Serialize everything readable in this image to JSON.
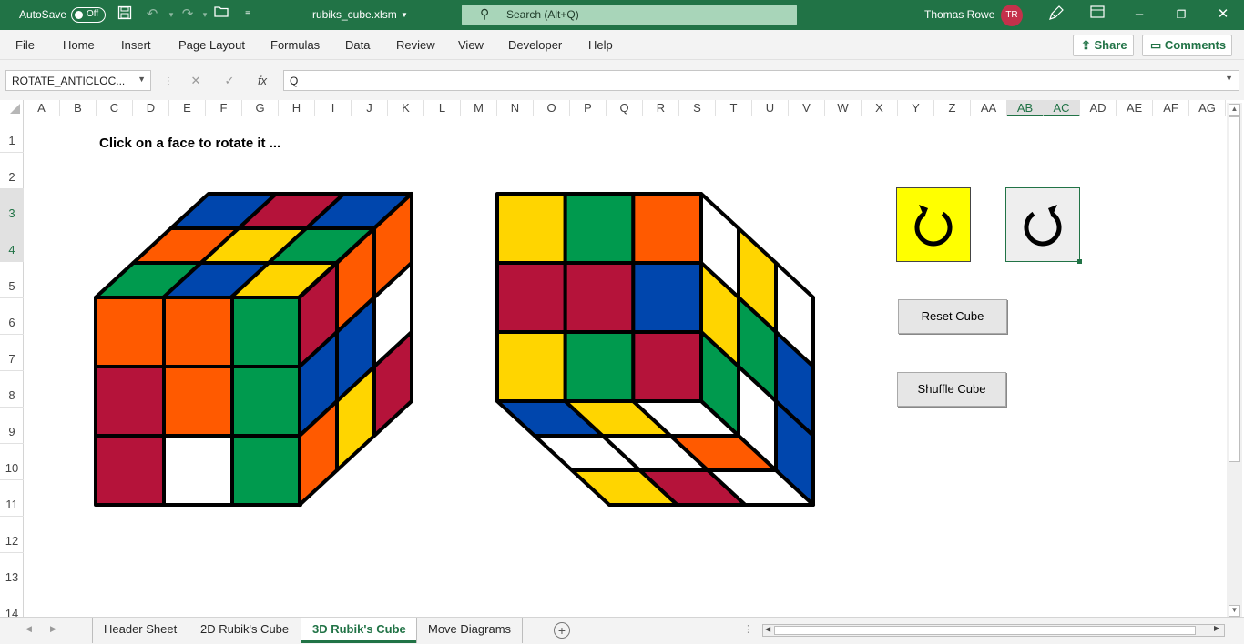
{
  "titlebar": {
    "autosave_label": "AutoSave",
    "autosave_state": "Off",
    "filename": "rubiks_cube.xlsm",
    "search_placeholder": "Search (Alt+Q)",
    "user_name": "Thomas Rowe",
    "user_initials": "TR"
  },
  "menu": [
    "File",
    "Home",
    "Insert",
    "Page Layout",
    "Formulas",
    "Data",
    "Review",
    "View",
    "Developer",
    "Help"
  ],
  "ribbon_right": {
    "share": "Share",
    "comments": "Comments"
  },
  "formula_bar": {
    "name_box": "ROTATE_ANTICLOC...",
    "formula": "Q"
  },
  "columns": [
    "A",
    "B",
    "C",
    "D",
    "E",
    "F",
    "G",
    "H",
    "I",
    "J",
    "K",
    "L",
    "M",
    "N",
    "O",
    "P",
    "Q",
    "R",
    "S",
    "T",
    "U",
    "V",
    "W",
    "X",
    "Y",
    "Z",
    "AA",
    "AB",
    "AC",
    "AD",
    "AE",
    "AF",
    "AG"
  ],
  "rows": [
    "1",
    "2",
    "3",
    "4",
    "5",
    "6",
    "7",
    "8",
    "9",
    "10",
    "11",
    "12",
    "13",
    "14"
  ],
  "sheet": {
    "prompt": "Click on a face to rotate it ...",
    "reset_button": "Reset Cube",
    "shuffle_button": "Shuffle Cube",
    "rotate_clockwise_icon": "rotate-clockwise-icon",
    "rotate_anticlockwise_icon": "rotate-anticlockwise-icon"
  },
  "colors": {
    "excel_green": "#217346",
    "red": "#B5133A",
    "orange": "#FF5A00",
    "green": "#009A4E",
    "blue": "#0046AD",
    "yellow": "#FFD500",
    "white": "#FFFFFF"
  },
  "cube_left": {
    "front": [
      [
        "orange",
        "orange",
        "green"
      ],
      [
        "red",
        "orange",
        "green"
      ],
      [
        "red",
        "white",
        "green"
      ]
    ],
    "top": [
      [
        "blue",
        "red",
        "blue"
      ],
      [
        "orange",
        "yellow",
        "green"
      ],
      [
        "green",
        "blue",
        "yellow"
      ]
    ],
    "right": [
      [
        "orange",
        "white",
        "red"
      ],
      [
        "orange",
        "blue",
        "yellow"
      ],
      [
        "red",
        "blue",
        "orange"
      ]
    ]
  },
  "cube_right": {
    "back": [
      [
        "yellow",
        "green",
        "orange"
      ],
      [
        "red",
        "red",
        "blue"
      ],
      [
        "yellow",
        "green",
        "red"
      ]
    ],
    "right": [
      [
        "white",
        "yellow",
        "white"
      ],
      [
        "yellow",
        "green",
        "blue"
      ],
      [
        "green",
        "white",
        "blue"
      ]
    ],
    "bottom": [
      [
        "blue",
        "yellow",
        "white"
      ],
      [
        "white",
        "white",
        "orange"
      ],
      [
        "yellow",
        "red",
        "white"
      ]
    ]
  },
  "sheet_tabs": [
    "Header Sheet",
    "2D Rubik's Cube",
    "3D Rubik's Cube",
    "Move Diagrams"
  ],
  "active_tab": "3D Rubik's Cube"
}
